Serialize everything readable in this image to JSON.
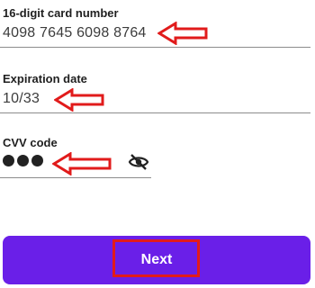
{
  "card_number": {
    "label": "16-digit card number",
    "value": "4098 7645 6098 8764"
  },
  "expiration": {
    "label": "Expiration date",
    "value": "10/33"
  },
  "cvv": {
    "label": "CVV code",
    "masked_digits": 3,
    "toggle_icon": "eye-slash-icon"
  },
  "button": {
    "label": "Next"
  },
  "colors": {
    "accent": "#6a1fe8",
    "annotation": "#e11b1b",
    "text": "#1f1f1f",
    "underline": "#8c8c8c"
  }
}
